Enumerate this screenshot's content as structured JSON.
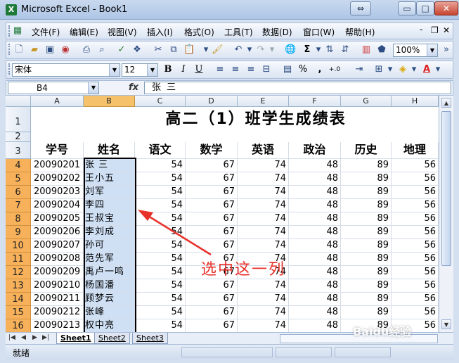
{
  "window": {
    "title": "Microsoft Excel - Book1",
    "app_icon": "X",
    "restore_glyph": "⇔",
    "min_glyph": "▭",
    "max_glyph": "□",
    "close_glyph": "✕"
  },
  "menu": {
    "items": [
      "文件(F)",
      "编辑(E)",
      "视图(V)",
      "插入(I)",
      "格式(O)",
      "工具(T)",
      "数据(D)",
      "窗口(W)",
      "帮助(H)"
    ],
    "right_icons": [
      "-",
      "❐",
      "✕"
    ]
  },
  "toolbar1": {
    "zoom": "100%",
    "sum_glyph": "Σ"
  },
  "toolbar2": {
    "font_name": "宋体",
    "font_size": "12",
    "bold": "B",
    "italic": "I",
    "underline": "U",
    "percent": "%",
    "comma": ",",
    "decimals": "+.0",
    "font_color_label": "A"
  },
  "formula_bar": {
    "cell_ref": "B4",
    "fx": "fx",
    "value": "张  三"
  },
  "sheet": {
    "title": "高二（1）班学生成绩表",
    "columns": [
      "A",
      "B",
      "C",
      "D",
      "E",
      "F",
      "G",
      "H"
    ],
    "selected_column": "B",
    "row_numbers": [
      "1",
      "2",
      "3",
      "4",
      "5",
      "6",
      "7",
      "8",
      "9",
      "10",
      "11",
      "12",
      "13",
      "14",
      "15",
      "16"
    ],
    "headers": [
      "学号",
      "姓名",
      "语文",
      "数学",
      "英语",
      "政治",
      "历史",
      "地理"
    ],
    "rows": [
      [
        "20090201",
        "张  三",
        "54",
        "67",
        "74",
        "48",
        "89",
        "56"
      ],
      [
        "20090202",
        "王小五",
        "54",
        "67",
        "74",
        "48",
        "89",
        "56"
      ],
      [
        "20090203",
        "刘军",
        "54",
        "67",
        "74",
        "48",
        "89",
        "56"
      ],
      [
        "20090204",
        "李四",
        "54",
        "67",
        "74",
        "48",
        "89",
        "56"
      ],
      [
        "20090205",
        "王叔宝",
        "54",
        "67",
        "74",
        "48",
        "89",
        "56"
      ],
      [
        "20090206",
        "李刘成",
        "54",
        "67",
        "74",
        "48",
        "89",
        "56"
      ],
      [
        "20090207",
        "孙可",
        "54",
        "67",
        "74",
        "48",
        "89",
        "56"
      ],
      [
        "20090208",
        "范先军",
        "54",
        "67",
        "74",
        "48",
        "89",
        "56"
      ],
      [
        "20090209",
        "禹卢一鸣",
        "54",
        "67",
        "74",
        "48",
        "89",
        "56"
      ],
      [
        "20090210",
        "杨国潘",
        "54",
        "67",
        "74",
        "48",
        "89",
        "56"
      ],
      [
        "20090211",
        "顾梦云",
        "54",
        "67",
        "74",
        "48",
        "89",
        "56"
      ],
      [
        "20090212",
        "张峰",
        "54",
        "67",
        "74",
        "48",
        "89",
        "56"
      ],
      [
        "20090213",
        "权中亮",
        "54",
        "67",
        "74",
        "48",
        "89",
        "56"
      ]
    ]
  },
  "sheet_tabs": [
    "Sheet1",
    "Sheet2",
    "Sheet3"
  ],
  "status": {
    "text": "就绪"
  },
  "annotation": {
    "text": "选中这一列",
    "color": "#e8312a"
  },
  "watermark": {
    "text": "Baidu经验"
  },
  "colors": {
    "selection_fill": "#cfe0f5",
    "header_highlight": "#f7b15a"
  }
}
